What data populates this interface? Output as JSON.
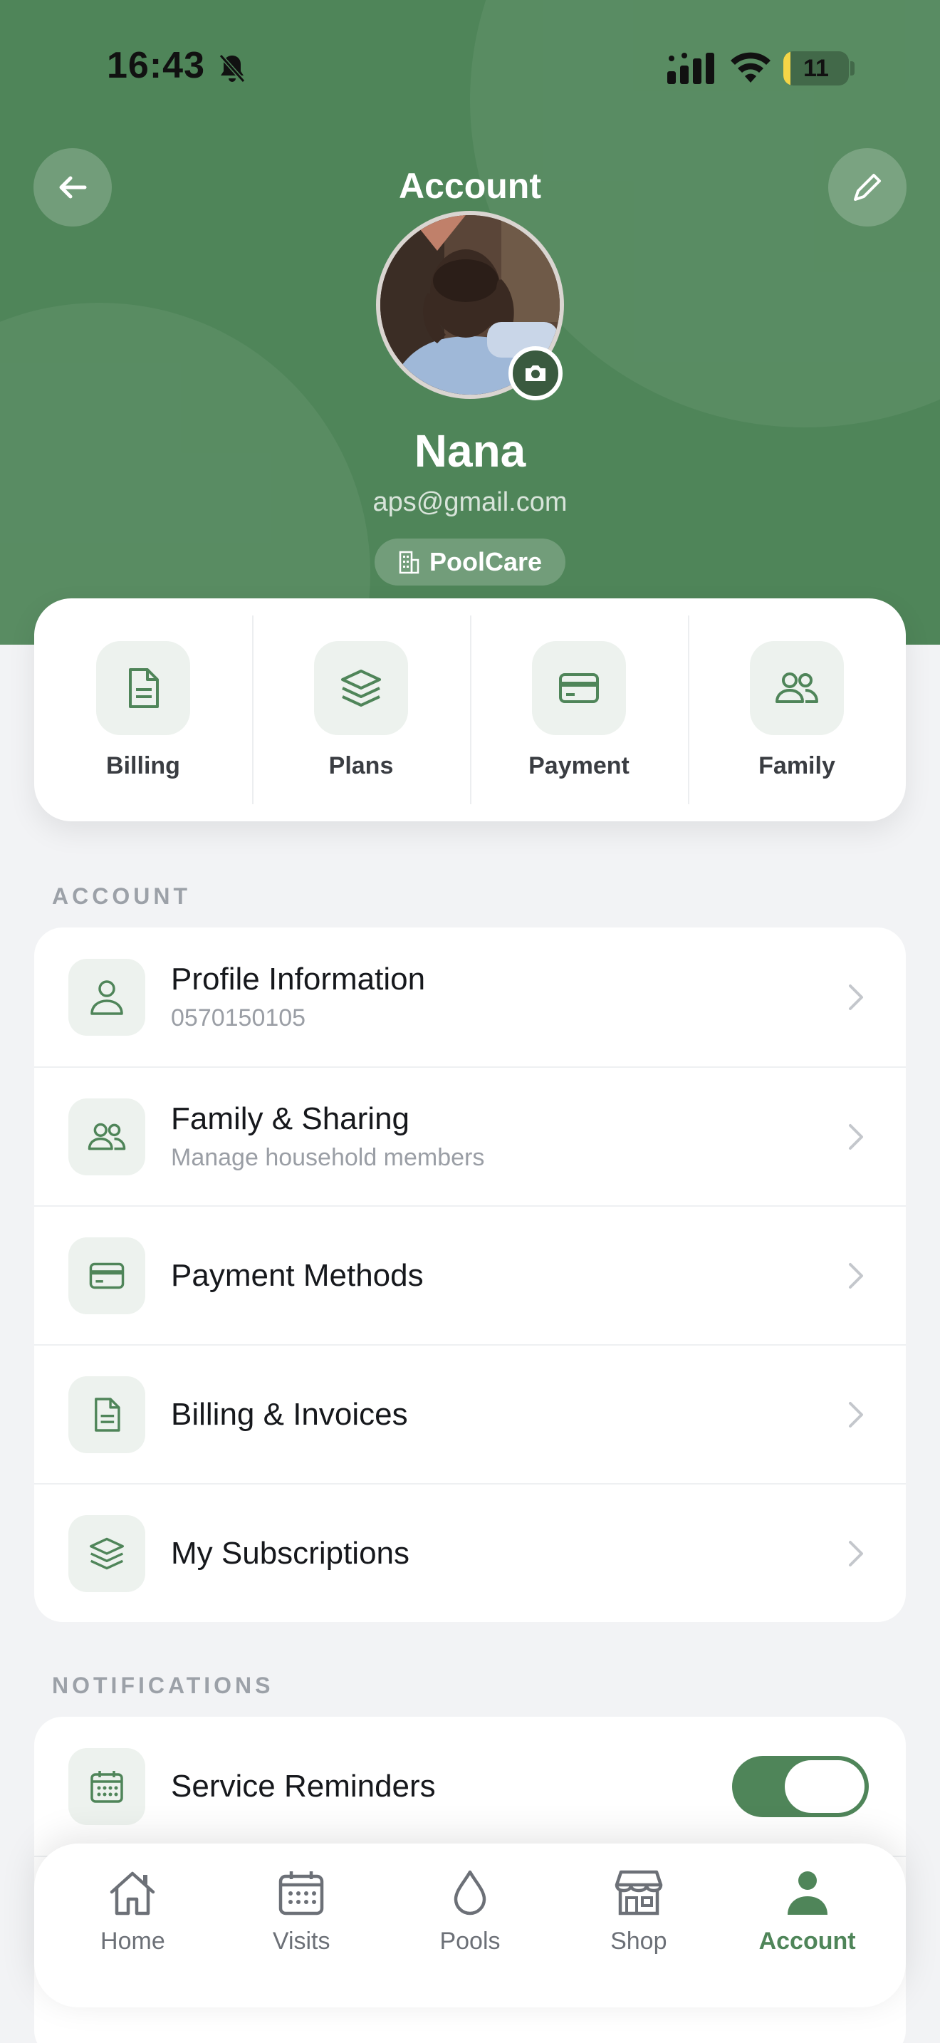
{
  "status_bar": {
    "time": "16:43",
    "battery": "11",
    "battery_level": 0.11
  },
  "header": {
    "title": "Account",
    "name": "Nana",
    "email": "aps@gmail.com",
    "organization": "PoolCare",
    "back_icon": "arrow-left-icon",
    "edit_icon": "pencil-icon"
  },
  "quick_actions": [
    {
      "label": "Billing",
      "icon": "document-icon"
    },
    {
      "label": "Plans",
      "icon": "layers-icon"
    },
    {
      "label": "Payment",
      "icon": "card-icon"
    },
    {
      "label": "Family",
      "icon": "users-icon"
    }
  ],
  "account_section": {
    "title": "ACCOUNT",
    "items": [
      {
        "title": "Profile Information",
        "subtitle": "0570150105",
        "icon": "user-icon"
      },
      {
        "title": "Family & Sharing",
        "subtitle": "Manage household members",
        "icon": "users-icon"
      },
      {
        "title": "Payment Methods",
        "subtitle": "",
        "icon": "card-icon"
      },
      {
        "title": "Billing & Invoices",
        "subtitle": "",
        "icon": "document-icon"
      },
      {
        "title": "My Subscriptions",
        "subtitle": "",
        "icon": "layers-icon"
      }
    ]
  },
  "notifications_section": {
    "title": "NOTIFICATIONS",
    "items": [
      {
        "title": "Service Reminders",
        "enabled": true,
        "icon": "calendar-icon"
      }
    ]
  },
  "tab_bar": {
    "tabs": [
      {
        "label": "Home",
        "icon": "home-icon"
      },
      {
        "label": "Visits",
        "icon": "calendar-icon"
      },
      {
        "label": "Pools",
        "icon": "droplet-icon"
      },
      {
        "label": "Shop",
        "icon": "store-icon"
      },
      {
        "label": "Account",
        "icon": "person-icon",
        "active": true
      }
    ]
  },
  "colors": {
    "brand": "#4f8559",
    "background": "#f2f3f5",
    "icon_tile": "#edf2ee"
  }
}
